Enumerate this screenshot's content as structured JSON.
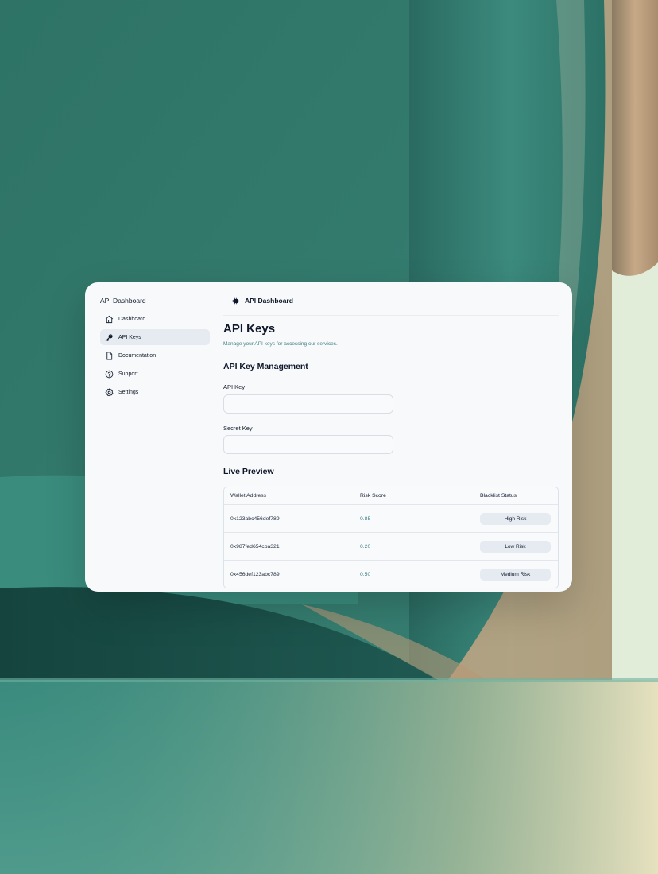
{
  "sidebar": {
    "title": "API Dashboard",
    "items": [
      {
        "label": "Dashboard",
        "icon": "home-icon",
        "active": false
      },
      {
        "label": "API Keys",
        "icon": "key-icon",
        "active": true
      },
      {
        "label": "Documentation",
        "icon": "document-icon",
        "active": false
      },
      {
        "label": "Support",
        "icon": "help-circle-icon",
        "active": false
      },
      {
        "label": "Settings",
        "icon": "gear-icon",
        "active": false
      }
    ]
  },
  "header": {
    "brand": "API Dashboard",
    "brand_icon": "cpu-chip-icon",
    "actions": [
      "bell-icon",
      "user-avatar"
    ]
  },
  "main": {
    "title": "API Keys",
    "subtitle": "Manage your API keys for accessing our services.",
    "management": {
      "title": "API Key Management",
      "fields": [
        {
          "label": "API Key",
          "value": "",
          "placeholder": ""
        },
        {
          "label": "Secret Key",
          "value": "",
          "placeholder": ""
        }
      ]
    },
    "preview": {
      "title": "Live Preview",
      "columns": [
        "Wallet Address",
        "Risk Score",
        "Blacklist Status"
      ],
      "rows": [
        {
          "wallet": "0x123abc456def789",
          "score": "0.85",
          "status": "High Risk"
        },
        {
          "wallet": "0x987fed654cba321",
          "score": "0.20",
          "status": "Low Risk"
        },
        {
          "wallet": "0x456def123abc789",
          "score": "0.50",
          "status": "Medium Risk"
        }
      ]
    }
  },
  "colors": {
    "accent_text": "#3f7f84",
    "active_nav_bg": "#e6ebf1",
    "panel_bg": "#f7f9fb",
    "background_teal": "#2f7a6d"
  }
}
